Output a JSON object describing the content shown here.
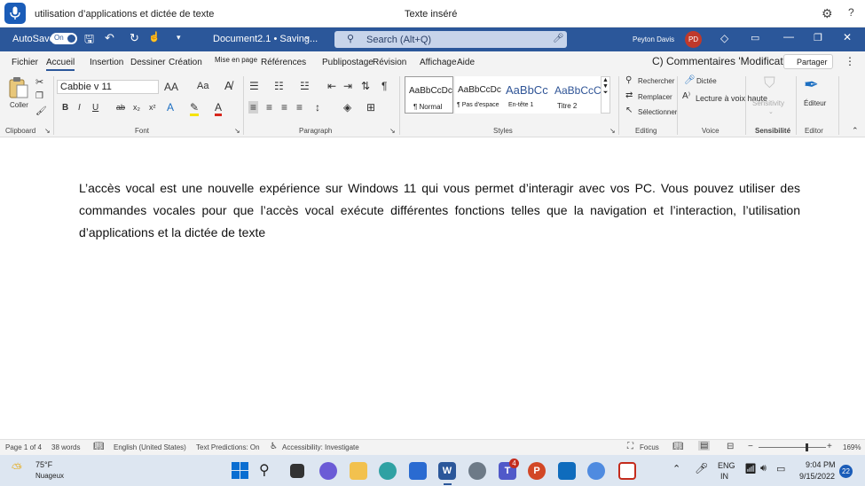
{
  "voice_bar": {
    "dictation_text": "utilisation d’applications et dictée de texte",
    "status": "Texte inséré",
    "settings_icon": "gear-icon",
    "help_label": "?"
  },
  "title_bar": {
    "autosave_label": "AutoSave",
    "autosave_state": "On",
    "doc_title": "Document2.1 • Saving... ",
    "search_placeholder": "Search (Alt+Q)",
    "user_name": "Peyton Davis",
    "user_initials": "PD"
  },
  "menu": {
    "items": [
      "Fichier",
      "Accueil",
      "Insertion",
      "Dessiner",
      "Création",
      "Mise en page",
      "Références",
      "Publipostage",
      "Révision",
      "Affichage",
      "Aide"
    ],
    "comments_label": "C) Commentaires 'Modification",
    "share_label": "Partager"
  },
  "ribbon": {
    "clipboard": {
      "paste_label": "Coller",
      "group_label": "Clipboard"
    },
    "font": {
      "font_name": "Cabbie v 11",
      "group_label": "Font",
      "grow": "AA",
      "case": "Aa",
      "bold": "B",
      "italic": "I",
      "underline": "U",
      "strike": "ab",
      "sub": "x₂",
      "sup": "x²",
      "effects": "A",
      "highlight": "✎",
      "color": "A"
    },
    "paragraph": {
      "group_label": "Paragraph",
      "pilcrow": "¶"
    },
    "styles": {
      "group_label": "Styles",
      "items": [
        {
          "preview": "AaBbCcDc",
          "name": "¶ Normal"
        },
        {
          "preview": "AaBbCcDc",
          "name": "¶ Pas d'espace"
        },
        {
          "preview": "AaBbCc",
          "name": "En-tête 1"
        },
        {
          "preview": "AaBbCcC",
          "name": "Titre 2"
        }
      ]
    },
    "editing": {
      "find": "Rechercher",
      "replace": "Remplacer",
      "select": "Sélectionner",
      "group_label": "Editing"
    },
    "voice": {
      "dictate": "Dictée",
      "read_aloud": "Lecture à voix haute",
      "group_label": "Voice"
    },
    "sensitivity": {
      "label": "Sensitivity",
      "group_label": "Sensibilité"
    },
    "editor": {
      "label": "Éditeur",
      "group_label": "Editor"
    }
  },
  "document": {
    "body": "L’accès vocal est une nouvelle expérience sur Windows 11 qui vous permet d’interagir avec vos PC. Vous pouvez utiliser des commandes vocales pour que l’accès vocal exécute différentes fonctions telles que la navigation et l’interaction, l’utilisation d’applications et la dictée de texte"
  },
  "status_bar": {
    "page": "Page 1 of 4",
    "words": "38 words",
    "language": "English (United States)",
    "predictions": "Text Predictions: On",
    "accessibility": "Accessibility: Investigate",
    "focus": "Focus",
    "zoom": "169%",
    "zoom_level": 169
  },
  "taskbar": {
    "weather_temp": "75°F",
    "weather_desc": "Nuageux",
    "lang_top": "ENG",
    "lang_bottom": "IN",
    "time": "9:04 PM",
    "date": "9/15/2022",
    "notif_count": "22",
    "teams_badge": "4"
  },
  "colors": {
    "word_blue": "#2b579a",
    "ribbon_bg": "#f3f3f3",
    "voice_mic": "#1a5cb8",
    "taskbar_bg": "#dde6f1"
  }
}
